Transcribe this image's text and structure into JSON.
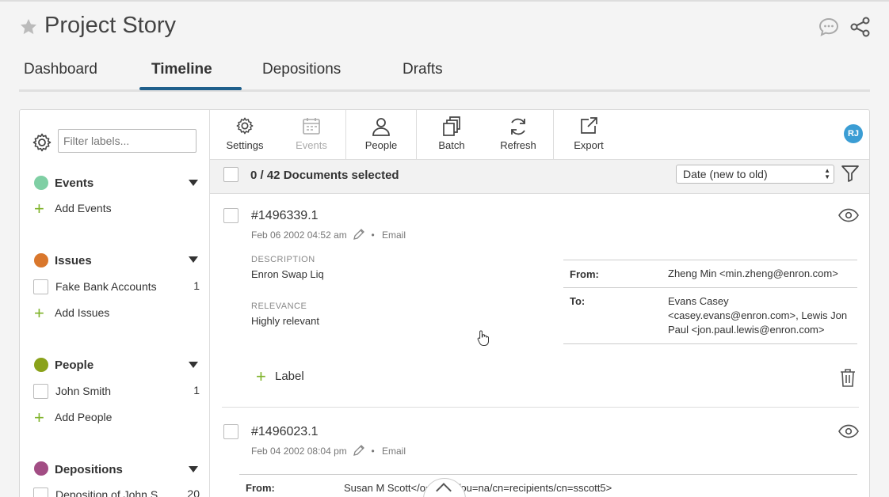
{
  "header": {
    "title": "Project Story"
  },
  "tabs": [
    {
      "label": "Dashboard"
    },
    {
      "label": "Timeline"
    },
    {
      "label": "Depositions"
    },
    {
      "label": "Drafts"
    }
  ],
  "sidebar": {
    "filter_placeholder": "Filter labels...",
    "groups": [
      {
        "title": "Events",
        "color": "#7fcfa4",
        "add_label": "Add Events"
      },
      {
        "title": "Issues",
        "color": "#d9772c",
        "items": [
          {
            "label": "Fake Bank Accounts",
            "count": "1"
          }
        ],
        "add_label": "Add Issues"
      },
      {
        "title": "People",
        "color": "#8aa21a",
        "items": [
          {
            "label": "John Smith",
            "count": "1"
          }
        ],
        "add_label": "Add People"
      },
      {
        "title": "Depositions",
        "color": "#a24d84",
        "items": [
          {
            "label": "Deposition of John S...",
            "count": "20"
          }
        ]
      }
    ]
  },
  "toolbar": {
    "settings": "Settings",
    "events": "Events",
    "people": "People",
    "batch": "Batch",
    "refresh": "Refresh",
    "export": "Export",
    "avatar": "RJ"
  },
  "selection": {
    "text": "0 / 42 Documents selected",
    "sort": "Date (new to old)"
  },
  "documents": [
    {
      "id": "#1496339.1",
      "date": "Feb 06 2002 04:52 am",
      "type": "Email",
      "description_label": "DESCRIPTION",
      "description": "Enron Swap Liq",
      "relevance_label": "RELEVANCE",
      "relevance": "Highly relevant",
      "from_label": "From:",
      "from": "Zheng Min <min.zheng@enron.com>",
      "to_label": "To:",
      "to": "Evans Casey <casey.evans@enron.com>, Lewis Jon Paul <jon.paul.lewis@enron.com>",
      "label_button": "Label"
    },
    {
      "id": "#1496023.1",
      "date": "Feb 04 2002 08:04 pm",
      "type": "Email",
      "from_label": "From:",
      "from": "Susan M Scott</o=enron/ou=na/cn=recipients/cn=sscott5>"
    }
  ],
  "colors": {
    "accent": "#1f5f8b",
    "plus": "#7fb32a",
    "avatar": "#3b9dd4"
  },
  "icons": [
    "star-icon",
    "chat-icon",
    "share-icon",
    "gear-icon",
    "calendar-icon",
    "person-icon",
    "batch-icon",
    "refresh-icon",
    "export-icon",
    "filter-icon",
    "eye-icon",
    "pencil-icon",
    "trash-icon",
    "chevron-up-icon"
  ]
}
